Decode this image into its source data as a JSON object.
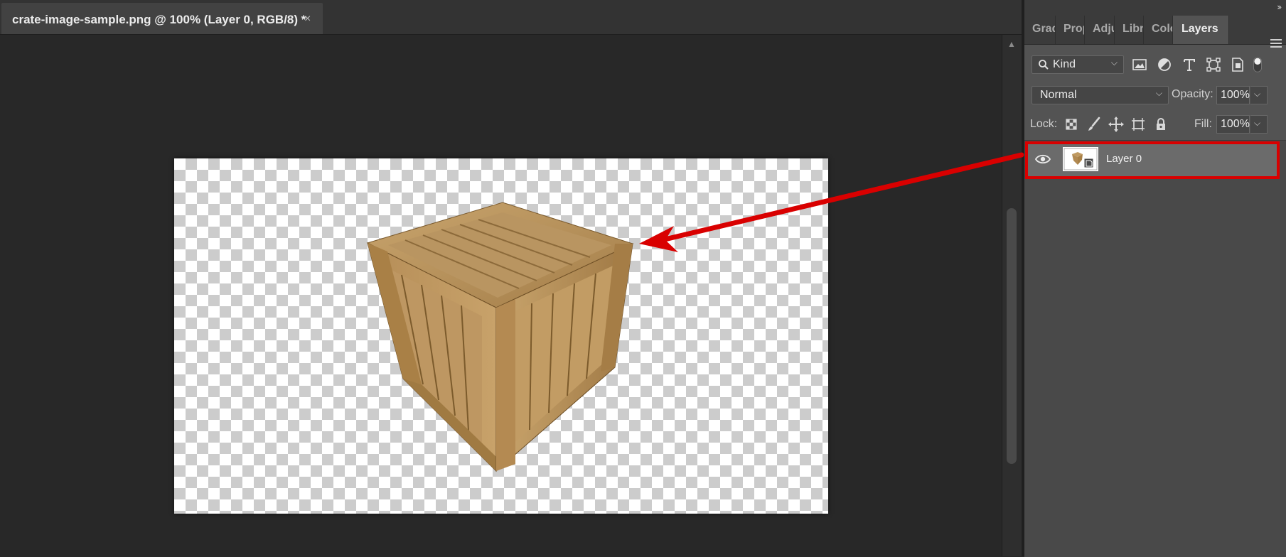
{
  "document": {
    "tab_title": "crate-image-sample.png @ 100% (Layer 0, RGB/8) *",
    "close_glyph": "×"
  },
  "panel": {
    "tabs": [
      {
        "label": "Grad",
        "active": false
      },
      {
        "label": "Prop",
        "active": false
      },
      {
        "label": "Adju",
        "active": false
      },
      {
        "label": "Libra",
        "active": false
      },
      {
        "label": "Colo",
        "active": false
      },
      {
        "label": "Layers",
        "active": true
      }
    ],
    "collapse_glyph": "››",
    "filter": {
      "kind_label": "Kind",
      "icons": [
        "pixel-layer-filter-icon",
        "adjustment-layer-filter-icon",
        "type-layer-filter-icon",
        "shape-layer-filter-icon",
        "smart-object-filter-icon",
        "filter-toggle-icon"
      ]
    },
    "blend_mode": "Normal",
    "opacity_label": "Opacity:",
    "opacity_value": "100%",
    "lock_label": "Lock:",
    "lock_icons": [
      "lock-transparent-pixels-icon",
      "lock-image-pixels-icon",
      "lock-position-icon",
      "lock-artboard-icon",
      "lock-all-icon"
    ],
    "fill_label": "Fill:",
    "fill_value": "100%",
    "layers": [
      {
        "name": "Layer 0",
        "visible": true,
        "selected": true,
        "highlighted": true
      }
    ]
  },
  "colors": {
    "highlight": "#d90000",
    "arrow": "#d90000",
    "panel_bg": "#535353",
    "canvas_bg": "#282828"
  }
}
